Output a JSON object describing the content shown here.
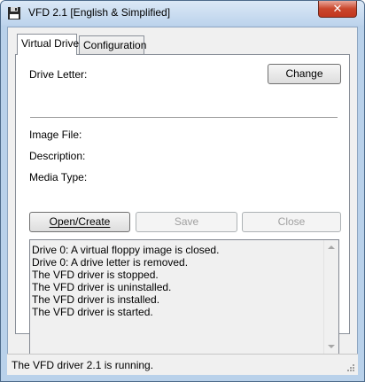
{
  "window": {
    "title": "VFD 2.1 [English & Simplified]",
    "close_label": "✕"
  },
  "tabs": [
    {
      "label": "Virtual Drive",
      "active": true
    },
    {
      "label": "Configuration",
      "active": false
    }
  ],
  "drive": {
    "drive_letter_label": "Drive Letter:",
    "change_button": "Change",
    "image_file_label": "Image File:",
    "description_label": "Description:",
    "media_type_label": "Media Type:"
  },
  "actions": {
    "open_create": "Open/Create",
    "save": "Save",
    "close": "Close"
  },
  "log": {
    "lines": [
      "Drive 0: A virtual floppy image is closed.",
      "Drive 0: A drive letter is removed.",
      "The VFD driver is stopped.",
      "The VFD driver is uninstalled.",
      "The VFD driver is installed.",
      "The VFD driver is started."
    ]
  },
  "status": {
    "text": "The VFD driver 2.1 is running."
  },
  "colors": {
    "titlebar": "#bcd3ec",
    "close_button": "#c9462c",
    "window_face": "#f0f0f0"
  }
}
